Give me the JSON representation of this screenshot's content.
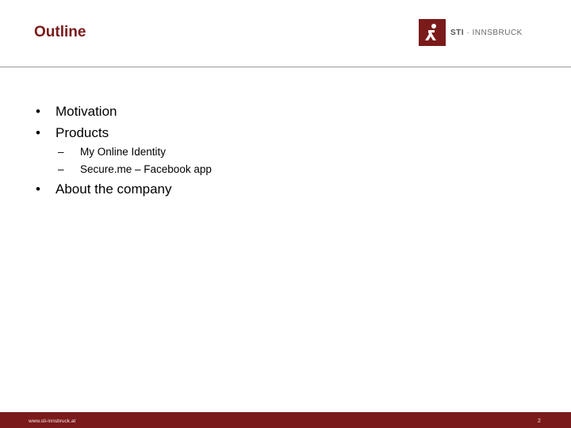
{
  "header": {
    "title": "Outline",
    "logo": {
      "sti": "STI",
      "separator": " · ",
      "place": "INNSBRUCK",
      "mark_icon": "sti-figure-icon"
    }
  },
  "outline": {
    "bullet": "•",
    "dash": "–",
    "items": [
      {
        "label": "Motivation"
      },
      {
        "label": "Products",
        "subitems": [
          "My Online Identity",
          "Secure.me – Facebook app"
        ]
      },
      {
        "label": "About the company"
      }
    ]
  },
  "footer": {
    "url": "www.sti-innsbruck.at",
    "page": "2"
  },
  "colors": {
    "accent": "#7b1a1a",
    "rule": "#9a9a9a",
    "text": "#000000"
  }
}
